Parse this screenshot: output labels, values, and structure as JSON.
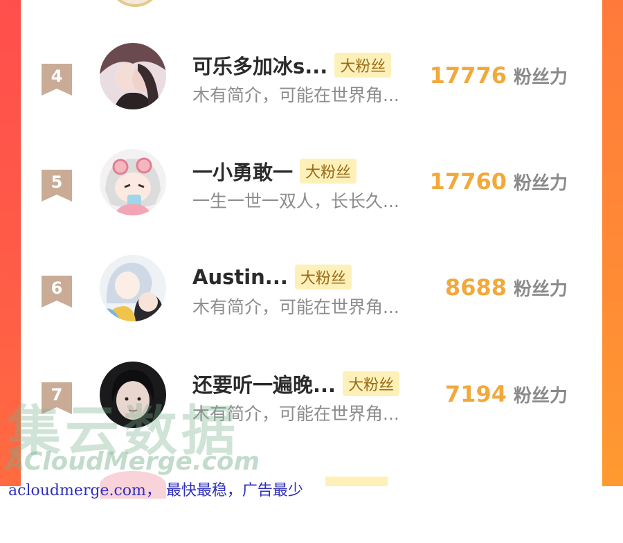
{
  "ranking": {
    "unit_label": "粉丝力",
    "rows": [
      {
        "rank": "4",
        "name": "可乐多加冰s...",
        "badge": "大粉丝",
        "intro": "木有简介，可能在世界角...",
        "score": "17776",
        "avatar": "anime-couple-avatar"
      },
      {
        "rank": "5",
        "name": "一小勇敢一",
        "badge": "大粉丝",
        "intro": "一生一世一双人，长长久...",
        "score": "17760",
        "avatar": "anime-girl-goggles-avatar"
      },
      {
        "rank": "6",
        "name": "Austin...",
        "badge": "大粉丝",
        "intro": "木有简介，可能在世界角...",
        "score": "8688",
        "avatar": "anime-duo-avatar"
      },
      {
        "rank": "7",
        "name": "还要听一遍晚...",
        "badge": "大粉丝",
        "intro": "木有简介，可能在世界角...",
        "score": "7194",
        "avatar": "photo-girl-avatar"
      }
    ]
  },
  "watermark": {
    "cn": "集云数据",
    "en": "ACloudMerge.com"
  },
  "footer": {
    "text": "acloudmerge.com， 最快最稳，广告最少"
  },
  "colors": {
    "frame_left": "#ff4f4c",
    "frame_right": "#ff9a30",
    "score": "#f2a93b",
    "badge_bg": "#fdf0b8",
    "rank_badge": "#c9ab96"
  }
}
